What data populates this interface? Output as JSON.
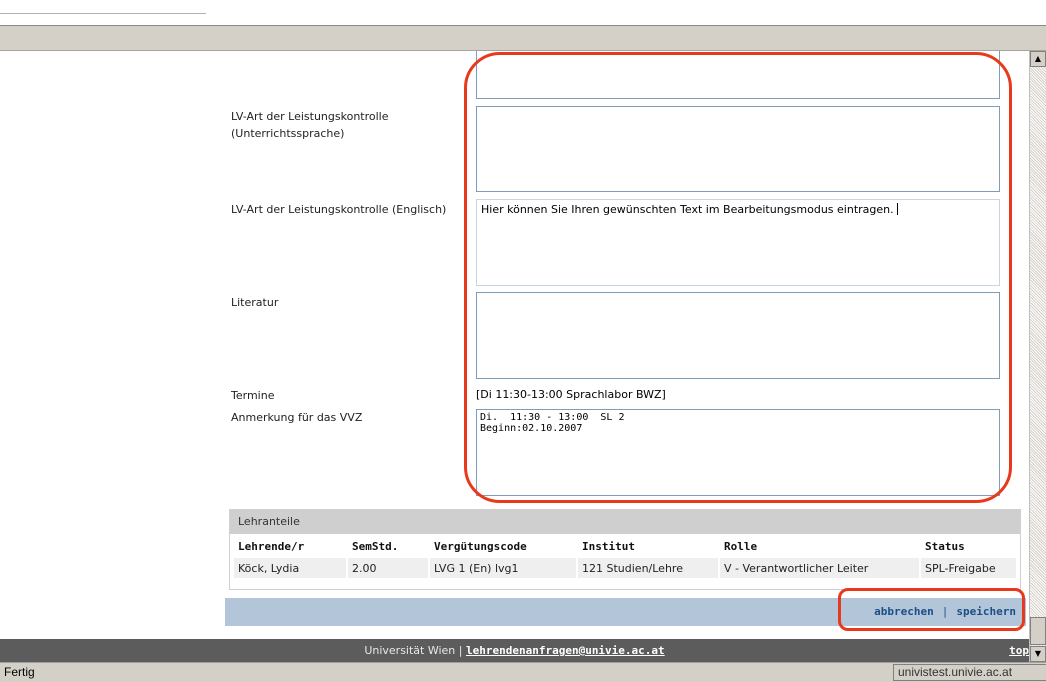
{
  "form": {
    "lv_art_unterricht_label_line1": "LV-Art der Leistungskontrolle",
    "lv_art_unterricht_label_line2": "(Unterrichtssprache)",
    "lv_art_englisch_label": "LV-Art der Leistungskontrolle (Englisch)",
    "lv_art_englisch_value": "Hier können Sie Ihren gewünschten Text im Bearbeitungsmodus eintragen.",
    "literatur_label": "Literatur",
    "termine_label": "Termine",
    "termine_value": "[Di 11:30-13:00 Sprachlabor BWZ]",
    "anmerkung_label": "Anmerkung für das VVZ",
    "anmerkung_value": "Di.  11:30 - 13:00  SL 2\nBeginn:02.10.2007"
  },
  "lehranteile": {
    "title": "Lehranteile",
    "columns": [
      "Lehrende/r",
      "SemStd.",
      "Vergütungscode",
      "Institut",
      "Rolle",
      "Status"
    ],
    "rows": [
      [
        "Köck, Lydia",
        "2.00",
        "LVG 1 (En) lvg1",
        "121 Studien/Lehre",
        "V - Verantwortlicher Leiter",
        "SPL-Freigabe"
      ]
    ]
  },
  "actions": {
    "cancel": "abbrechen",
    "separator": "|",
    "save": "speichern"
  },
  "footer": {
    "org": "Universität Wien |",
    "email": "lehrendenanfragen@univie.ac.at",
    "top": "top"
  },
  "statusbar": {
    "status": "Fertig",
    "host": "univistest.univie.ac.at"
  },
  "colors": {
    "highlight": "#e8391d",
    "action_bar": "#b3c5d8",
    "footer": "#5c5c5c",
    "link": "#1b4f86"
  }
}
